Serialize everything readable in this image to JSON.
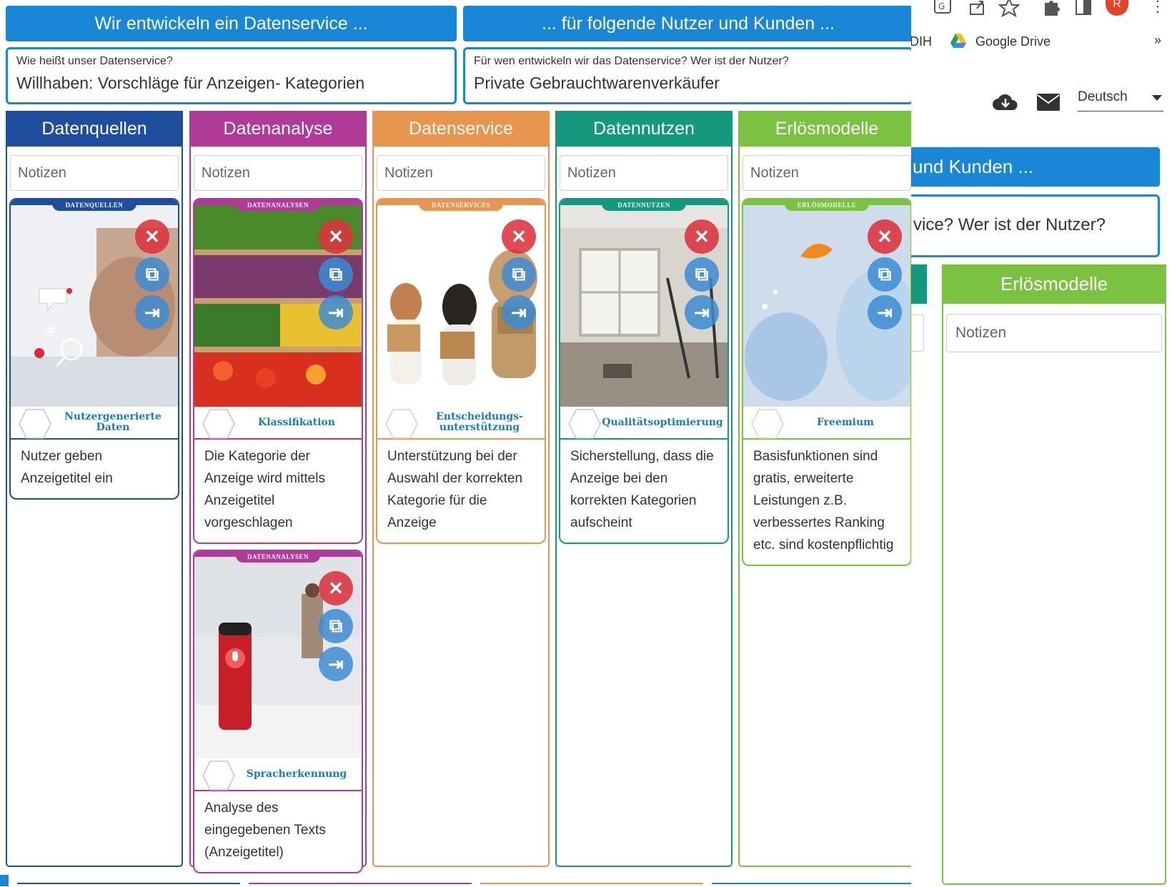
{
  "banners": {
    "left": "Wir entwickeln ein Datenservice ...",
    "right": "... für folgende Nutzer und Kunden ..."
  },
  "questions": {
    "service_q": "Wie heißt unser Datenservice?",
    "service_a": "Willhaben: Vorschläge für Anzeigen- Kategorien",
    "user_q": "Für wen entwickeln wir das Datenservice? Wer ist der Nutzer?",
    "user_a": "Private Gebrauchtwarenverkäufer"
  },
  "columns": [
    {
      "title": "Datenquellen",
      "color": "#1f4e9e",
      "notes_placeholder": "Notizen"
    },
    {
      "title": "Datenanalyse",
      "color": "#b03a98",
      "notes_placeholder": "Notizen"
    },
    {
      "title": "Datenservice",
      "color": "#e8964f",
      "notes_placeholder": "Notizen"
    },
    {
      "title": "Datennutzen",
      "color": "#14997f",
      "notes_placeholder": "Notizen"
    },
    {
      "title": "Erlösmodelle",
      "color": "#7cc242",
      "notes_placeholder": "Notizen"
    }
  ],
  "cards": {
    "c1": {
      "ribbon": "DATENQUELLEN",
      "label": "Nutzergenerierte Daten",
      "desc": "Nutzer geben Anzeigetitel ein"
    },
    "c2": {
      "ribbon": "DATENANALYSEN",
      "label": "Klassifikation",
      "desc": "Die Kategorie der Anzeige wird mittels Anzeigetitel vorgeschlagen"
    },
    "c3": {
      "ribbon": "DATENANALYSEN",
      "label": "Spracherkennung",
      "desc": "Analyse des eingegebenen Texts (Anzeigetitel)"
    },
    "c4": {
      "ribbon": "DATENSERVICES",
      "label": "Entscheidungs- unterstützung",
      "desc": "Unterstützung bei der Auswahl der korrekten Kategorie für die Anzeige"
    },
    "c5": {
      "ribbon": "DATENNUTZEN",
      "label": "Qualitätsoptimierung",
      "desc": "Sicherstellung, dass die Anzeige bei den korrekten Kategorien aufscheint"
    },
    "c6": {
      "ribbon": "ERLÖSMODELLE",
      "label": "Freemium",
      "desc": "Basisfunktionen sind gratis, erweiterte Leistungen z.B. verbessertes Ranking etc. sind kostenpflichtig"
    }
  },
  "card_actions": {
    "delete": "✕",
    "open": "⧉",
    "move": "⇥"
  },
  "browser": {
    "bookmark_partial": "DIH",
    "bookmark_drive": "Google Drive",
    "overflow": "»",
    "profile_initial": "R",
    "language": "Deutsch",
    "menu_dots": "⋮"
  },
  "right_view": {
    "banner_partial": "und Kunden ...",
    "question_partial": "vice? Wer ist der Nutzer?",
    "column_title": "Erlösmodelle",
    "notes_placeholder": "Notizen"
  },
  "icons": [
    "translate-icon",
    "share-icon",
    "star-icon",
    "puzzle-icon",
    "sidepanel-icon",
    "cloud-download-icon",
    "mail-icon",
    "caret-down-icon",
    "google-drive-icon"
  ]
}
